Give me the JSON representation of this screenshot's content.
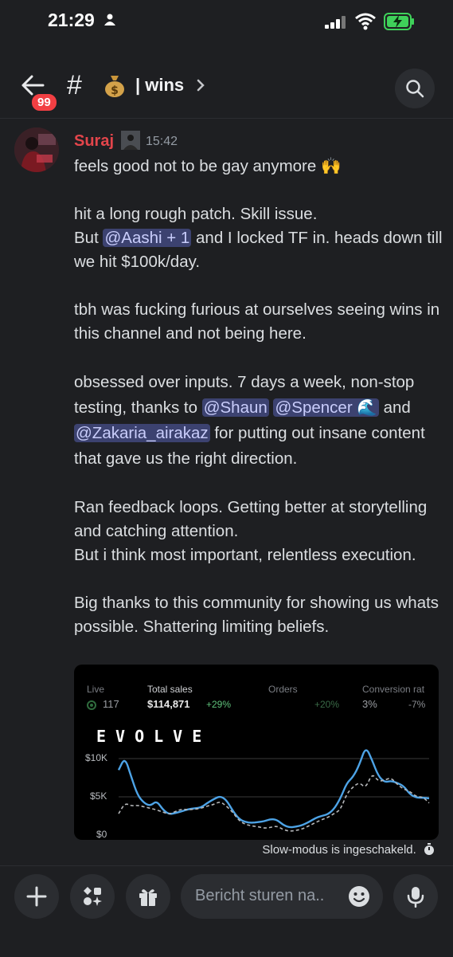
{
  "status": {
    "time": "21:29"
  },
  "header": {
    "unread_badge": "99",
    "channel_prefix": "#",
    "channel_emoji": "💰",
    "channel_name": "| wins"
  },
  "message": {
    "author": "Suraj",
    "time": "15:42",
    "line1": "feels good not to be gay anymore 🙌",
    "p2_a": "hit a long rough patch. Skill issue.",
    "p2_b": "But ",
    "mention_aashi": "@Aashi + 1",
    "p2_c": "  and I locked TF in. heads down till we hit $100k/day.",
    "p3": "tbh was fucking furious at ourselves seeing wins in this channel and not being here.",
    "p4_a": "obsessed over inputs. 7 days a week, non-stop testing, thanks to ",
    "mention_shaun": "@Shaun",
    "mention_spencer": "@Spencer 🌊",
    "p4_b": "  and ",
    "mention_zakaria": "@Zakaria_airakaz",
    "p4_c": " for putting out insane content that gave us the right direction.",
    "p5_a": "Ran feedback loops. Getting better at storytelling and catching attention.",
    "p5_b": "But i think most important, relentless execution.",
    "p6": "Big thanks to this community for showing us whats possible. Shattering limiting beliefs."
  },
  "attachment": {
    "live_label": "Live",
    "live_value": "117",
    "sales_label": "Total sales",
    "sales_value": "$114,871",
    "sales_change": "+29%",
    "orders_label": "Orders",
    "orders_change": "+20%",
    "conv_label": "Conversion rat",
    "conv_value": "3%",
    "conv_change": "-7%",
    "logo_text": "EVOLVE",
    "y_ticks": [
      "$10K",
      "$5K",
      "$0"
    ]
  },
  "chart_data": {
    "type": "line",
    "ylim": [
      0,
      11000
    ],
    "series": [
      {
        "values": [
          8500,
          10200,
          7600,
          5200,
          4200,
          3800,
          4500,
          3300,
          2700,
          2900,
          3100,
          3400,
          3500,
          3600,
          4200,
          4700,
          5100,
          4600,
          3200,
          2100,
          1700,
          1600,
          1700,
          1800,
          2100,
          2000,
          1300,
          1000,
          1100,
          1300,
          1700,
          2200,
          2500,
          2700,
          3400,
          4800,
          6800,
          7600,
          9200,
          11600,
          9800,
          7700,
          6900,
          7100,
          6800,
          6400,
          5300,
          4900,
          4900,
          4800
        ]
      },
      {
        "values": [
          2800,
          4200,
          3800,
          3900,
          3700,
          3500,
          3300,
          3000,
          2700,
          3100,
          3400,
          3300,
          3400,
          3500,
          3800,
          4000,
          4400,
          3800,
          3000,
          1900,
          1400,
          1200,
          1100,
          900,
          1000,
          1200,
          700,
          500,
          600,
          800,
          1200,
          1600,
          2000,
          2300,
          2800,
          3300,
          5400,
          6300,
          6900,
          6100,
          8100,
          7000,
          7200,
          7500,
          6600,
          6000,
          5700,
          5000,
          5000,
          4200
        ]
      }
    ]
  },
  "slow_mode": "Slow-modus is ingeschakeld.",
  "composer": {
    "placeholder": "Bericht sturen na.."
  }
}
